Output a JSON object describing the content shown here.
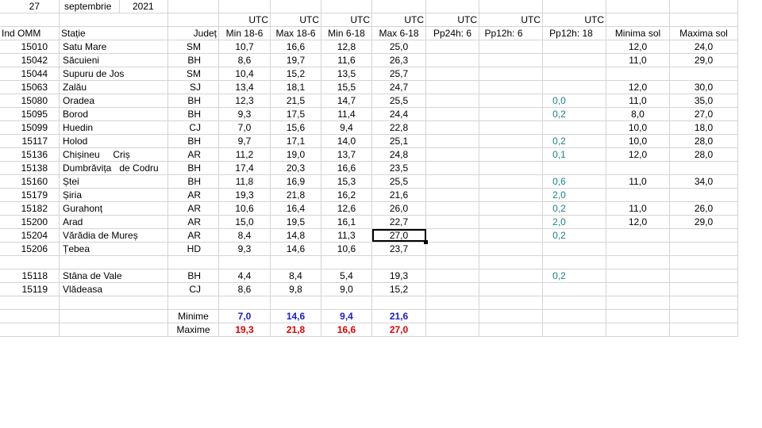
{
  "header": {
    "day": "27",
    "month": "septembrie",
    "year": "2021"
  },
  "utc_row": {
    "utc1": "UTC",
    "utc2": "UTC",
    "utc3": "UTC",
    "utc4": "UTC",
    "utc5": "UTC",
    "utc6": "UTC",
    "utc7": "UTC"
  },
  "columns": {
    "ind": "Ind OMM",
    "station": "Stație",
    "county": "Județ",
    "min186": "Min 18-6",
    "max186": "Max 18-6",
    "min618": "Min 6-18",
    "max618": "Max 6-18",
    "pp24": "Pp24h: 6",
    "pp12a": "Pp12h: 6",
    "pp12b": "Pp12h: 18",
    "minsol": "Minima sol",
    "maxsol": "Maxima sol"
  },
  "rows": [
    {
      "ind": "15010",
      "station": "Satu Mare",
      "county": "SM",
      "min186": "10,7",
      "max186": "16,6",
      "min618": "12,8",
      "max618": "25,0",
      "pp12b": "",
      "minsol": "12,0",
      "maxsol": "24,0"
    },
    {
      "ind": "15042",
      "station": "Săcuieni",
      "county": "BH",
      "min186": "8,6",
      "max186": "19,7",
      "min618": "11,6",
      "max618": "26,3",
      "pp12b": "",
      "minsol": "11,0",
      "maxsol": "29,0"
    },
    {
      "ind": "15044",
      "station": "Supuru de Jos",
      "county": "SM",
      "min186": "10,4",
      "max186": "15,2",
      "min618": "13,5",
      "max618": "25,7",
      "pp12b": "",
      "minsol": "",
      "maxsol": ""
    },
    {
      "ind": "15063",
      "station": "Zalău",
      "county": "SJ",
      "min186": "13,4",
      "max186": "18,1",
      "min618": "15,5",
      "max618": "24,7",
      "pp12b": "",
      "minsol": "12,0",
      "maxsol": "30,0"
    },
    {
      "ind": "15080",
      "station": "Oradea",
      "county": "BH",
      "min186": "12,3",
      "max186": "21,5",
      "min618": "14,7",
      "max618": "25,5",
      "pp12b": "0,0",
      "minsol": "11,0",
      "maxsol": "35,0"
    },
    {
      "ind": "15095",
      "station": "Borod",
      "county": "BH",
      "min186": "9,3",
      "max186": "17,5",
      "min618": "11,4",
      "max618": "24,4",
      "pp12b": "0,2",
      "minsol": "8,0",
      "maxsol": "27,0"
    },
    {
      "ind": "15099",
      "station": "Huedin",
      "county": "CJ",
      "min186": "7,0",
      "max186": "15,6",
      "min618": "9,4",
      "max618": "22,8",
      "pp12b": "",
      "minsol": "10,0",
      "maxsol": "18,0"
    },
    {
      "ind": "15117",
      "station": "Holod",
      "county": "BH",
      "min186": "9,7",
      "max186": "17,1",
      "min618": "14,0",
      "max618": "25,1",
      "pp12b": "0,2",
      "minsol": "10,0",
      "maxsol": "28,0"
    },
    {
      "ind": "15136",
      "station": "Chișineu     Criș",
      "county": "AR",
      "min186": "11,2",
      "max186": "19,0",
      "min618": "13,7",
      "max618": "24,8",
      "pp12b": "0,1",
      "minsol": "12,0",
      "maxsol": "28,0"
    },
    {
      "ind": "15138",
      "station": "Dumbrăvița   de Codru",
      "county": "BH",
      "min186": "17,4",
      "max186": "20,3",
      "min618": "16,6",
      "max618": "23,5",
      "pp12b": "",
      "minsol": "",
      "maxsol": ""
    },
    {
      "ind": "15160",
      "station": "Ștei",
      "county": "BH",
      "min186": "11,8",
      "max186": "16,9",
      "min618": "15,3",
      "max618": "25,5",
      "pp12b": "0,6",
      "minsol": "11,0",
      "maxsol": "34,0"
    },
    {
      "ind": "15179",
      "station": "Șiria",
      "county": "AR",
      "min186": "19,3",
      "max186": "21,8",
      "min618": "16,2",
      "max618": "21,6",
      "pp12b": "2,0",
      "minsol": "",
      "maxsol": ""
    },
    {
      "ind": "15182",
      "station": "Gurahonț",
      "county": "AR",
      "min186": "10,6",
      "max186": "16,4",
      "min618": "12,6",
      "max618": "26,0",
      "pp12b": "0,2",
      "minsol": "11,0",
      "maxsol": "26,0"
    },
    {
      "ind": "15200",
      "station": "Arad",
      "county": "AR",
      "min186": "15,0",
      "max186": "19,5",
      "min618": "16,1",
      "max618": "22,7",
      "pp12b": "2,0",
      "minsol": "12,0",
      "maxsol": "29,0"
    },
    {
      "ind": "15204",
      "station": "Vărădia de Mureș",
      "county": "AR",
      "min186": "8,4",
      "max186": "14,8",
      "min618": "11,3",
      "max618": "27,0",
      "pp12b": "0,2",
      "minsol": "",
      "maxsol": ""
    },
    {
      "ind": "15206",
      "station": "Țebea",
      "county": "HD",
      "min186": "9,3",
      "max186": "14,6",
      "min618": "10,6",
      "max618": "23,7",
      "pp12b": "",
      "minsol": "",
      "maxsol": ""
    },
    {
      "ind": "",
      "station": "",
      "county": "",
      "min186": "",
      "max186": "",
      "min618": "",
      "max618": "",
      "pp12b": "",
      "minsol": "",
      "maxsol": ""
    },
    {
      "ind": "15118",
      "station": "Stâna de Vale",
      "county": "BH",
      "min186": "4,4",
      "max186": "8,4",
      "min618": "5,4",
      "max618": "19,3",
      "pp12b": "0,2",
      "minsol": "",
      "maxsol": ""
    },
    {
      "ind": "15119",
      "station": "Vlădeasa",
      "county": "CJ",
      "min186": "8,6",
      "max186": "9,8",
      "min618": "9,0",
      "max618": "15,2",
      "pp12b": "",
      "minsol": "",
      "maxsol": ""
    }
  ],
  "summary": {
    "minime": {
      "label": "Minime",
      "min186": "7,0",
      "max186": "14,6",
      "min618": "9,4",
      "max618": "21,6"
    },
    "maxime": {
      "label": "Maxime",
      "min186": "19,3",
      "max186": "21,8",
      "min618": "16,6",
      "max618": "27,0"
    }
  },
  "colors": {
    "min_summary": "#1a1acc",
    "max_summary": "#e00000",
    "precip": "#17808c",
    "grid": "#d4d4d4"
  }
}
